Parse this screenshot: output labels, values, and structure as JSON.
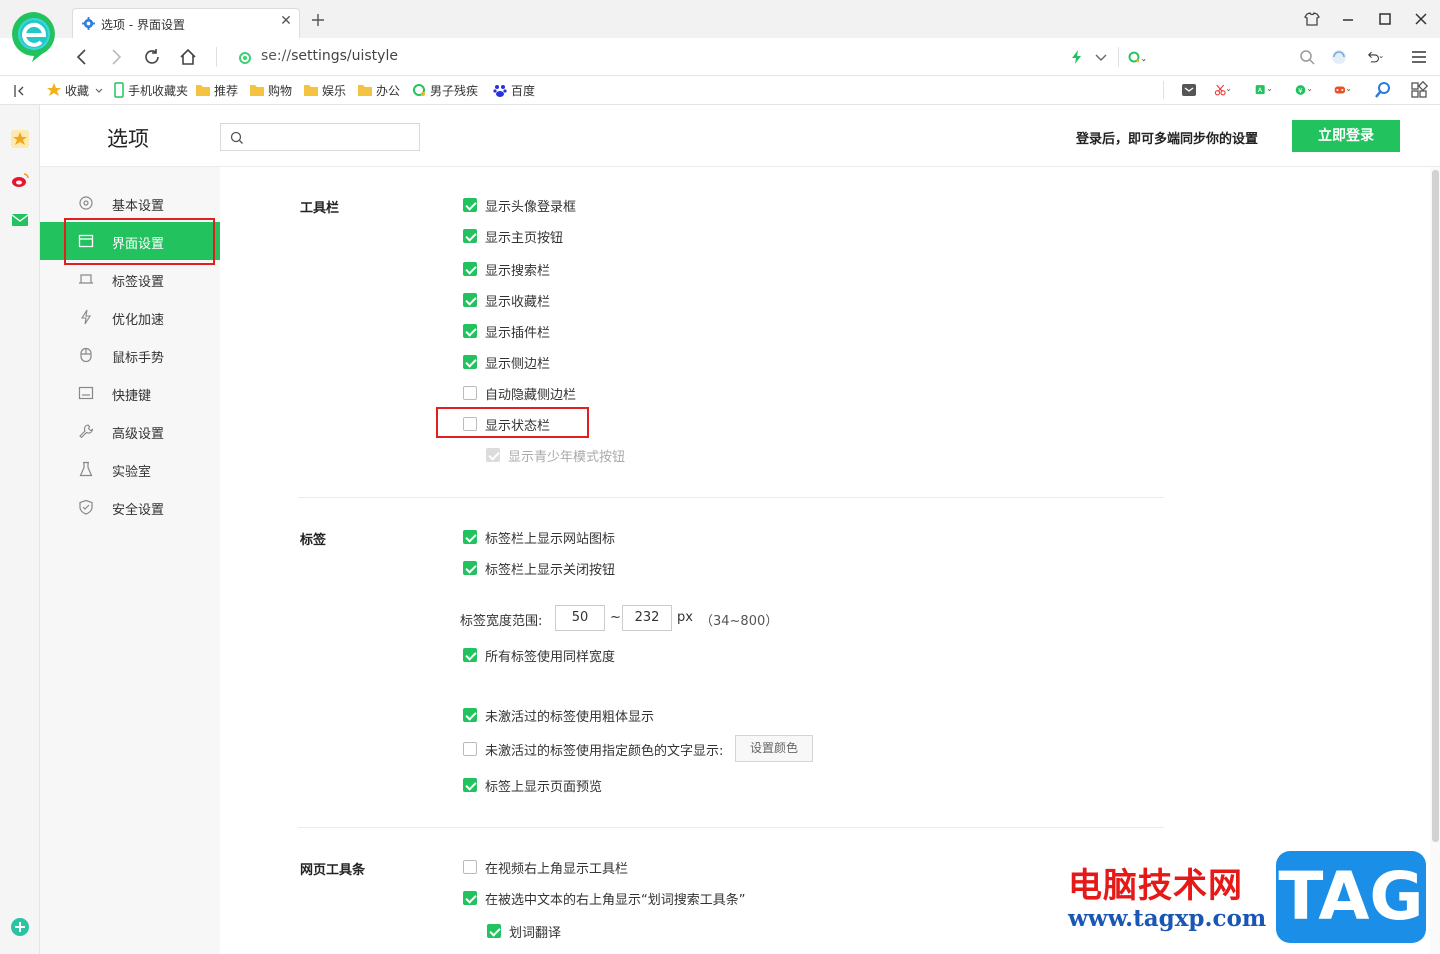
{
  "browser": {
    "tab_title": "选项 - 界面设置",
    "address_prefix": "se://",
    "address_path": "settings/uistyle"
  },
  "bookmarks": [
    {
      "label": "收藏",
      "icon": "star-icon"
    },
    {
      "label": "手机收藏夹",
      "icon": "phone-icon"
    },
    {
      "label": "推荐",
      "icon": "folder-icon"
    },
    {
      "label": "购物",
      "icon": "folder-icon"
    },
    {
      "label": "娱乐",
      "icon": "folder-icon"
    },
    {
      "label": "办公",
      "icon": "folder-icon"
    },
    {
      "label": "男子残疾",
      "icon": "search-engine-icon"
    },
    {
      "label": "百度",
      "icon": "baidu-paw-icon"
    }
  ],
  "header": {
    "title": "选项",
    "search_placeholder": "",
    "login_hint": "登录后，即可多端同步你的设置",
    "login_button": "立即登录"
  },
  "menu": [
    {
      "label": "基本设置",
      "icon": "gear-icon"
    },
    {
      "label": "界面设置",
      "icon": "window-icon",
      "active": true
    },
    {
      "label": "标签设置",
      "icon": "tab-icon"
    },
    {
      "label": "优化加速",
      "icon": "lightning-icon"
    },
    {
      "label": "鼠标手势",
      "icon": "mouse-icon"
    },
    {
      "label": "快捷键",
      "icon": "keyboard-icon"
    },
    {
      "label": "高级设置",
      "icon": "wrench-icon"
    },
    {
      "label": "实验室",
      "icon": "flask-icon"
    },
    {
      "label": "安全设置",
      "icon": "shield-icon"
    }
  ],
  "sections": {
    "toolbar": {
      "title": "工具栏",
      "options": [
        {
          "label": "显示头像登录框",
          "checked": true
        },
        {
          "label": "显示主页按钮",
          "checked": true
        },
        {
          "label": "显示搜索栏",
          "checked": true
        },
        {
          "label": "显示收藏栏",
          "checked": true
        },
        {
          "label": "显示插件栏",
          "checked": true
        },
        {
          "label": "显示侧边栏",
          "checked": true
        },
        {
          "label": "自动隐藏侧边栏",
          "checked": false
        },
        {
          "label": "显示状态栏",
          "checked": false
        },
        {
          "label": "显示青少年模式按钮",
          "checked": true,
          "disabled": true
        }
      ]
    },
    "tabs": {
      "title": "标签",
      "options": [
        {
          "label": "标签栏上显示网站图标",
          "checked": true
        },
        {
          "label": "标签栏上显示关闭按钮",
          "checked": true
        }
      ],
      "width_label": "标签宽度范围:",
      "width_min": "50",
      "width_tilde": "~",
      "width_max": "232",
      "width_unit": "px",
      "width_hint": "（34~800）",
      "options2": [
        {
          "label": "所有标签使用同样宽度",
          "checked": true
        },
        {
          "label": "未激活过的标签使用粗体显示",
          "checked": true
        },
        {
          "label": "未激活过的标签使用指定颜色的文字显示:",
          "checked": false
        },
        {
          "label": "标签上显示页面预览",
          "checked": true
        }
      ],
      "set_color_button": "设置颜色"
    },
    "webtoolbar": {
      "title": "网页工具条",
      "options": [
        {
          "label": "在视频右上角显示工具栏",
          "checked": false
        },
        {
          "label": "在被选中文本的右上角显示“划词搜索工具条”",
          "checked": true
        },
        {
          "label": "划词翻译",
          "checked": true
        }
      ]
    }
  },
  "watermark": {
    "cn": "电脑技术网",
    "url": "www.tagxp.com",
    "tag": "TAG"
  },
  "colors": {
    "accent": "#22c25f",
    "highlight": "#e02020"
  }
}
